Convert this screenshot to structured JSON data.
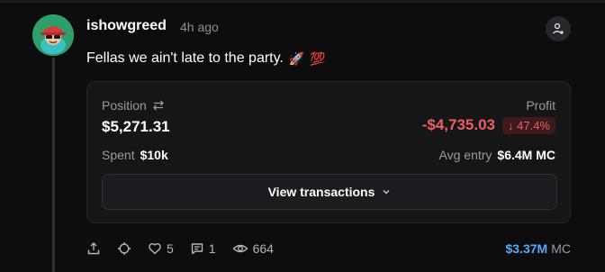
{
  "post": {
    "username": "ishowgreed",
    "time": "4h ago",
    "text": "Fellas we ain't late to the party.",
    "emojis": [
      "🚀",
      "💯"
    ]
  },
  "card": {
    "position_label": "Position",
    "position_value": "$5,271.31",
    "profit_label": "Profit",
    "profit_value": "-$4,735.03",
    "profit_pct": "↓ 47.4%",
    "spent_label": "Spent",
    "spent_value": "$10k",
    "avg_label": "Avg entry",
    "avg_value": "$6.4M MC",
    "view_button": "View transactions"
  },
  "actions": {
    "likes": "5",
    "comments": "1",
    "views": "664",
    "market_cap_value": "$3.37M",
    "market_cap_unit": "MC"
  },
  "colors": {
    "background": "#0d0d0f",
    "card": "#161619",
    "negative": "#ee5f63",
    "accent_blue": "#5aa9f3",
    "avatar_green": "#2e9e6a"
  }
}
